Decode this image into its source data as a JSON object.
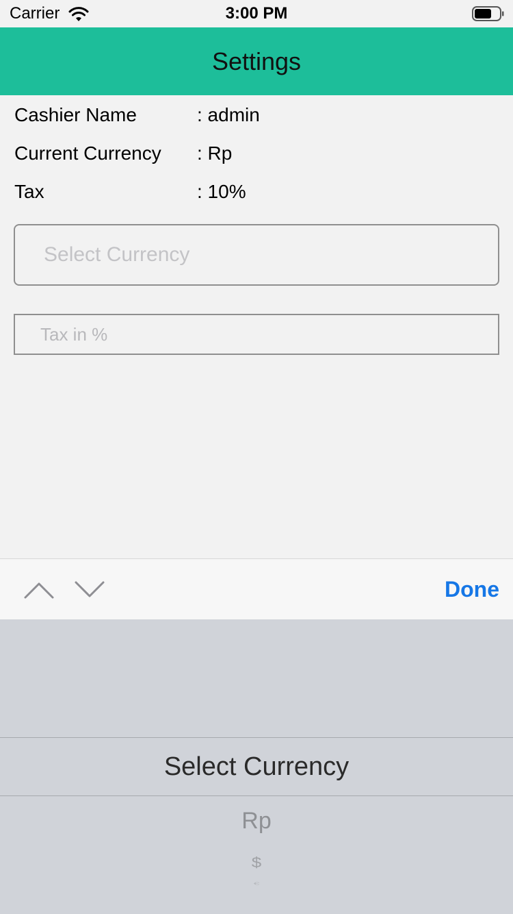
{
  "status_bar": {
    "carrier": "Carrier",
    "time": "3:00 PM",
    "wifi_icon": "wifi-icon",
    "battery_icon": "battery-icon"
  },
  "nav": {
    "title": "Settings",
    "background": "#1dbe9a"
  },
  "info": [
    {
      "label": "Cashier Name",
      "value": ": admin"
    },
    {
      "label": "Current Currency",
      "value": ": Rp"
    },
    {
      "label": "Tax",
      "value": ": 10%"
    }
  ],
  "currency_field": {
    "placeholder": "Select Currency"
  },
  "tax_field": {
    "placeholder": "Tax in %",
    "value": ""
  },
  "toolbar": {
    "prev_icon": "chevron-up-icon",
    "next_icon": "chevron-down-icon",
    "done_label": "Done",
    "accent": "#1677e6"
  },
  "picker": {
    "selected": "Select Currency",
    "options": [
      "Rp",
      "$",
      "€"
    ]
  }
}
